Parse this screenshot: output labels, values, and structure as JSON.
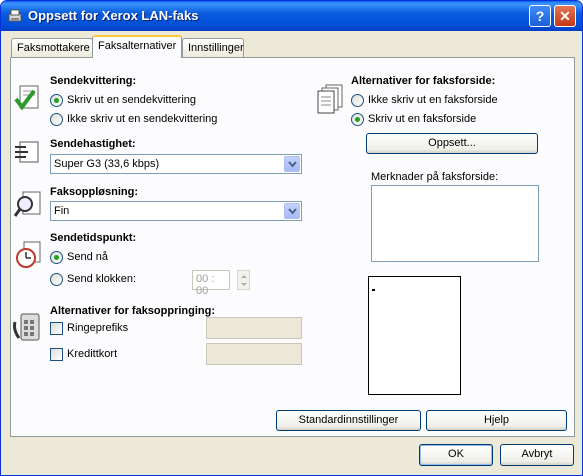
{
  "window": {
    "title": "Oppsett for Xerox LAN-faks",
    "help_glyph": "?",
    "close_glyph": "✕"
  },
  "tabs": [
    {
      "label": "Faksmottakere",
      "active": false
    },
    {
      "label": "Faksalternativer",
      "active": true
    },
    {
      "label": "Innstillinger",
      "active": false
    }
  ],
  "send_receipt": {
    "title": "Sendekvittering:",
    "options": [
      "Skriv ut en sendekvittering",
      "Ikke skriv ut en sendekvittering"
    ],
    "selected_index": 0
  },
  "send_speed": {
    "title": "Sendehastighet:",
    "value": "Super G3 (33,6 kbps)"
  },
  "fax_resolution": {
    "title": "Faksoppløsning:",
    "value": "Fin"
  },
  "send_time": {
    "title": "Sendetidspunkt:",
    "options": [
      "Send nå",
      "Send klokken:"
    ],
    "selected_index": 0,
    "time_value": "00 : 00"
  },
  "dialing": {
    "title": "Alternativer for faksoppringing:",
    "prefix_label": "Ringeprefiks",
    "prefix_checked": false,
    "credit_label": "Kredittkort",
    "credit_checked": false
  },
  "cover_sheet": {
    "title": "Alternativer for faksforside:",
    "options": [
      "Ikke skriv ut en faksforside",
      "Skriv ut en faksforside"
    ],
    "selected_index": 1,
    "setup_button": "Oppsett...",
    "notes_label": "Merknader på faksforside:",
    "notes_value": ""
  },
  "footer": {
    "defaults_button": "Standardinnstillinger",
    "help_button": "Hjelp",
    "ok_button": "OK",
    "cancel_button": "Avbryt"
  },
  "colors": {
    "title_bar": "#0a5ddc",
    "dialog_bg": "#ece9d8",
    "radio_dot": "#21a121",
    "active_tab_accent": "#ffc83c"
  }
}
